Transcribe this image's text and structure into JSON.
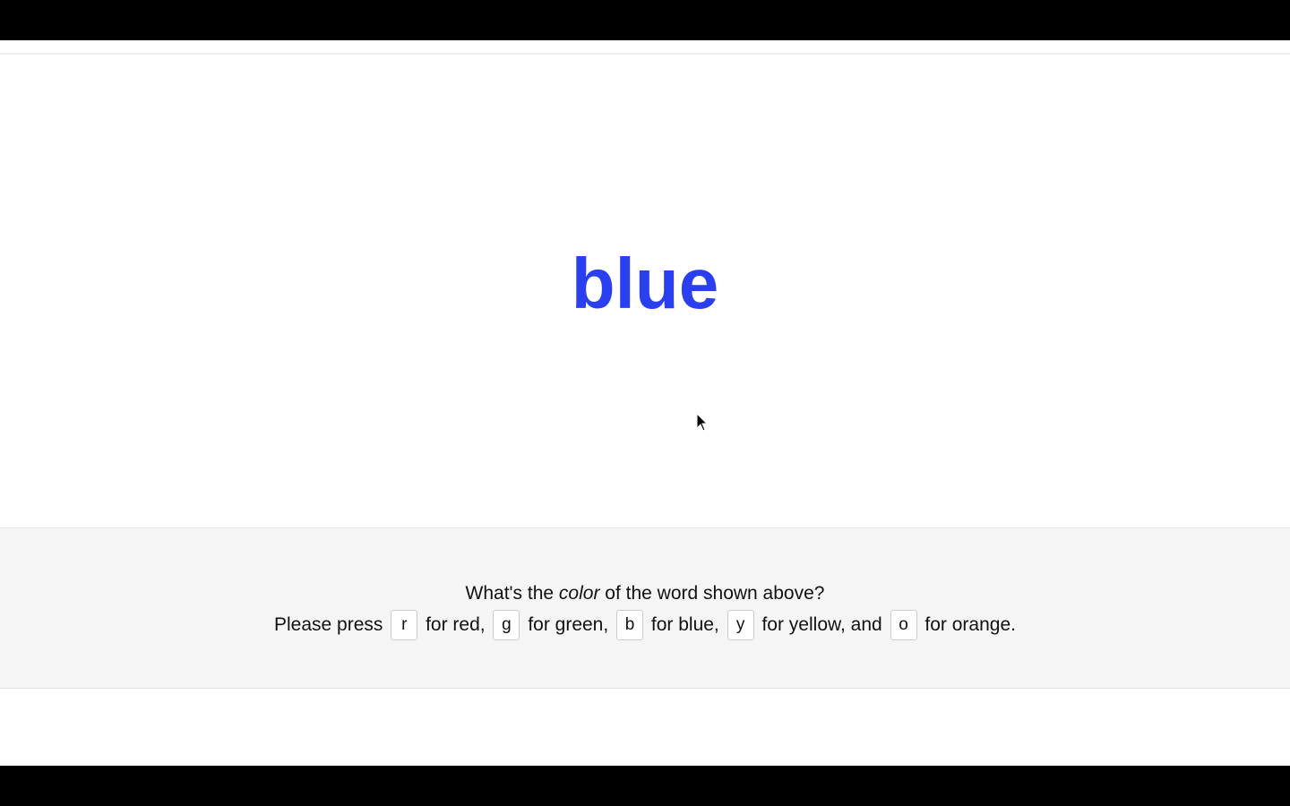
{
  "stimulus": {
    "word": "blue",
    "color": "#2a3ff0"
  },
  "prompt": {
    "before": "What's the ",
    "emph": "color",
    "after": " of the word shown above?"
  },
  "instructions": {
    "lead": "Please press",
    "keys": [
      {
        "key": "r",
        "text": "for red,"
      },
      {
        "key": "g",
        "text": "for green,"
      },
      {
        "key": "b",
        "text": "for blue,"
      },
      {
        "key": "y",
        "text": "for yellow, and"
      },
      {
        "key": "o",
        "text": "for orange."
      }
    ]
  },
  "icons": {
    "cursor": "mouse-pointer-icon"
  }
}
